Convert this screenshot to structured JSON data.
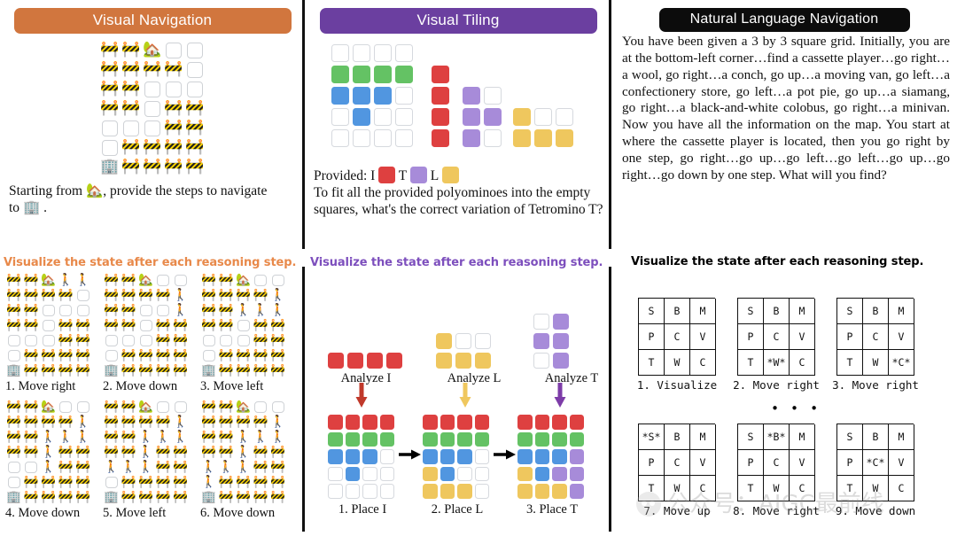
{
  "panels": {
    "nav": {
      "title": "Visual Navigation",
      "title_color": "#d1763e",
      "prompt_a": "Starting from",
      "prompt_b": ", provide the steps to navigate",
      "prompt_c": "to",
      "prompt_d": ".",
      "home_icon": "🏡",
      "office_icon": "🏢",
      "barrier_icon": "🚧",
      "walker_icon": "🚶",
      "viz_caption": "Visualize the state after each reasoning step.",
      "main_grid": [
        [
          "B",
          "B",
          "H",
          "E",
          "E"
        ],
        [
          "B",
          "B",
          "B",
          "B",
          "E"
        ],
        [
          "B",
          "B",
          "E",
          "E",
          "E"
        ],
        [
          "B",
          "B",
          "E",
          "B",
          "B"
        ],
        [
          "E",
          "E",
          "E",
          "B",
          "B"
        ],
        [
          "E",
          "B",
          "B",
          "B",
          "B"
        ],
        [
          "O",
          "B",
          "B",
          "B",
          "B"
        ]
      ],
      "steps": [
        {
          "label": "1. Move right",
          "grid": [
            [
              "B",
              "B",
              "H",
              "W",
              "W"
            ],
            [
              "B",
              "B",
              "B",
              "B",
              "E"
            ],
            [
              "B",
              "B",
              "E",
              "E",
              "E"
            ],
            [
              "B",
              "B",
              "E",
              "B",
              "B"
            ],
            [
              "E",
              "E",
              "E",
              "B",
              "B"
            ],
            [
              "E",
              "B",
              "B",
              "B",
              "B"
            ],
            [
              "O",
              "B",
              "B",
              "B",
              "B"
            ]
          ]
        },
        {
          "label": "2. Move down",
          "grid": [
            [
              "B",
              "B",
              "H",
              "E",
              "E"
            ],
            [
              "B",
              "B",
              "B",
              "B",
              "W"
            ],
            [
              "B",
              "B",
              "E",
              "E",
              "W"
            ],
            [
              "B",
              "B",
              "E",
              "B",
              "B"
            ],
            [
              "E",
              "E",
              "E",
              "B",
              "B"
            ],
            [
              "E",
              "B",
              "B",
              "B",
              "B"
            ],
            [
              "O",
              "B",
              "B",
              "B",
              "B"
            ]
          ]
        },
        {
          "label": "3. Move left",
          "grid": [
            [
              "B",
              "B",
              "H",
              "E",
              "E"
            ],
            [
              "B",
              "B",
              "B",
              "B",
              "W"
            ],
            [
              "B",
              "B",
              "W",
              "W",
              "W"
            ],
            [
              "B",
              "B",
              "E",
              "B",
              "B"
            ],
            [
              "E",
              "E",
              "E",
              "B",
              "B"
            ],
            [
              "E",
              "B",
              "B",
              "B",
              "B"
            ],
            [
              "O",
              "B",
              "B",
              "B",
              "B"
            ]
          ]
        },
        {
          "label": "4. Move down",
          "grid": [
            [
              "B",
              "B",
              "H",
              "E",
              "E"
            ],
            [
              "B",
              "B",
              "B",
              "B",
              "W"
            ],
            [
              "B",
              "B",
              "W",
              "W",
              "W"
            ],
            [
              "B",
              "B",
              "W",
              "B",
              "B"
            ],
            [
              "E",
              "E",
              "W",
              "B",
              "B"
            ],
            [
              "E",
              "B",
              "B",
              "B",
              "B"
            ],
            [
              "O",
              "B",
              "B",
              "B",
              "B"
            ]
          ]
        },
        {
          "label": "5. Move left",
          "grid": [
            [
              "B",
              "B",
              "H",
              "E",
              "E"
            ],
            [
              "B",
              "B",
              "B",
              "B",
              "W"
            ],
            [
              "B",
              "B",
              "W",
              "W",
              "W"
            ],
            [
              "B",
              "B",
              "W",
              "B",
              "B"
            ],
            [
              "W",
              "W",
              "W",
              "B",
              "B"
            ],
            [
              "E",
              "B",
              "B",
              "B",
              "B"
            ],
            [
              "O",
              "B",
              "B",
              "B",
              "B"
            ]
          ]
        },
        {
          "label": "6. Move down",
          "grid": [
            [
              "B",
              "B",
              "H",
              "E",
              "E"
            ],
            [
              "B",
              "B",
              "B",
              "B",
              "W"
            ],
            [
              "B",
              "B",
              "W",
              "W",
              "W"
            ],
            [
              "B",
              "B",
              "W",
              "B",
              "B"
            ],
            [
              "W",
              "W",
              "W",
              "B",
              "B"
            ],
            [
              "W",
              "B",
              "B",
              "B",
              "B"
            ],
            [
              "O",
              "B",
              "B",
              "B",
              "B"
            ]
          ]
        }
      ]
    },
    "tiling": {
      "title": "Visual Tiling",
      "title_color": "#6b3fa0",
      "provided_label": "Provided: I",
      "provided_t": "T",
      "provided_l": "L",
      "prompt": "To fit all the provided polyominoes into the empty squares, what's the correct variation of Tetromino T?",
      "viz_caption": "Visualize the state after each reasoning step.",
      "colors": {
        "red": "#de4040",
        "green": "#64c264",
        "blue": "#5196e0",
        "purple": "#a78bd9",
        "yellow": "#efc75e",
        "empty": "#ffffff"
      },
      "main_grid": [
        [
          "e",
          "e",
          "e",
          "e"
        ],
        [
          "g",
          "g",
          "g",
          "g"
        ],
        [
          "b",
          "b",
          "b",
          "e"
        ],
        [
          "e",
          "b",
          "e",
          "e"
        ],
        [
          "e",
          "e",
          "e",
          "e"
        ]
      ],
      "piece_i": [
        [
          "r"
        ],
        [
          "r"
        ],
        [
          "r"
        ],
        [
          "r"
        ]
      ],
      "piece_t": [
        [
          "p",
          "e"
        ],
        [
          "p",
          "p"
        ],
        [
          "p",
          "e"
        ]
      ],
      "piece_l": [
        [
          "y",
          "e",
          "e"
        ],
        [
          "y",
          "y",
          "y"
        ]
      ],
      "analyses": [
        {
          "label": "Analyze I",
          "grid": [
            [
              "r",
              "r",
              "r",
              "r"
            ]
          ],
          "cols": 4,
          "arrow_color": "#c0392b"
        },
        {
          "label": "Analyze L",
          "grid": [
            [
              "y",
              "e",
              "e"
            ],
            [
              "y",
              "y",
              "y"
            ]
          ],
          "cols": 3,
          "arrow_color": "#efc75e"
        },
        {
          "label": "Analyze T",
          "grid": [
            [
              "e",
              "p"
            ],
            [
              "p",
              "p"
            ],
            [
              "e",
              "p"
            ]
          ],
          "cols": 2,
          "arrow_color": "#7d3ca8"
        }
      ],
      "steps": [
        {
          "label": "1. Place I",
          "grid": [
            [
              "r",
              "r",
              "r",
              "r"
            ],
            [
              "g",
              "g",
              "g",
              "g"
            ],
            [
              "b",
              "b",
              "b",
              "e"
            ],
            [
              "e",
              "b",
              "e",
              "e"
            ],
            [
              "e",
              "e",
              "e",
              "e"
            ]
          ]
        },
        {
          "label": "2. Place L",
          "grid": [
            [
              "r",
              "r",
              "r",
              "r"
            ],
            [
              "g",
              "g",
              "g",
              "g"
            ],
            [
              "b",
              "b",
              "b",
              "e"
            ],
            [
              "y",
              "b",
              "e",
              "e"
            ],
            [
              "y",
              "y",
              "y",
              "e"
            ]
          ]
        },
        {
          "label": "3. Place T",
          "grid": [
            [
              "r",
              "r",
              "r",
              "r"
            ],
            [
              "g",
              "g",
              "g",
              "g"
            ],
            [
              "b",
              "b",
              "b",
              "p"
            ],
            [
              "y",
              "b",
              "p",
              "p"
            ],
            [
              "y",
              "y",
              "y",
              "p"
            ]
          ]
        }
      ]
    },
    "nlp": {
      "title": "Natural Language Navigation",
      "title_color": "#0c0c0c",
      "prompt": "You have been given a 3 by 3 square grid. Initially, you are at the bottom-left corner…find a cassette player…go right…a wool, go right…a conch, go up…a moving van, go left…a confectionery store, go left…a pot pie, go up…a siamang, go right…a black-and-white colobus, go right…a minivan. Now you have all the information on the map. You start at where the cassette player is located, then you go right by one step, go right…go up…go left…go left…go up…go right…go down by one step. What will you find?",
      "viz_caption": "Visualize the state after each reasoning step.",
      "ellipsis": "• • •",
      "steps": [
        {
          "label": "1. Visualize",
          "grid": [
            [
              "S",
              "B",
              "M"
            ],
            [
              "P",
              "C",
              "V"
            ],
            [
              "T",
              "W",
              "C"
            ]
          ]
        },
        {
          "label": "2. Move right",
          "grid": [
            [
              "S",
              "B",
              "M"
            ],
            [
              "P",
              "C",
              "V"
            ],
            [
              "T",
              "*W*",
              "C"
            ]
          ]
        },
        {
          "label": "3. Move right",
          "grid": [
            [
              "S",
              "B",
              "M"
            ],
            [
              "P",
              "C",
              "V"
            ],
            [
              "T",
              "W",
              "*C*"
            ]
          ]
        },
        {
          "label": "7. Move up",
          "grid": [
            [
              "*S*",
              "B",
              "M"
            ],
            [
              "P",
              "C",
              "V"
            ],
            [
              "T",
              "W",
              "C"
            ]
          ]
        },
        {
          "label": "8. Move right",
          "grid": [
            [
              "S",
              "*B*",
              "M"
            ],
            [
              "P",
              "C",
              "V"
            ],
            [
              "T",
              "W",
              "C"
            ]
          ]
        },
        {
          "label": "9. Move down",
          "grid": [
            [
              "S",
              "B",
              "M"
            ],
            [
              "P",
              "*C*",
              "V"
            ],
            [
              "T",
              "W",
              "C"
            ]
          ]
        }
      ]
    }
  },
  "watermark": {
    "text": "公众号：AIGC最前线"
  }
}
